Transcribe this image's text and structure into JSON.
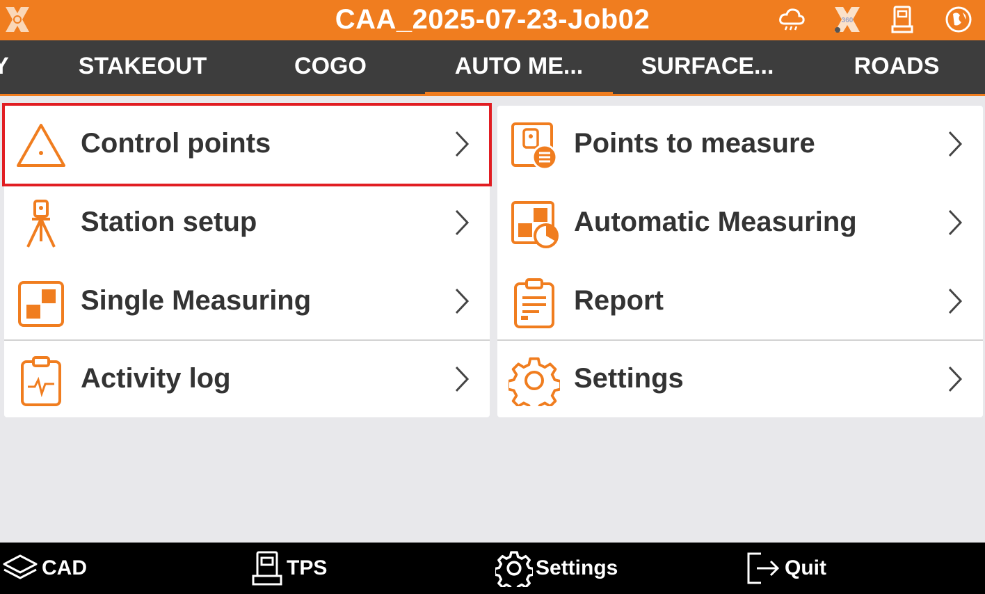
{
  "header": {
    "title": "CAA_2025-07-23-Job02"
  },
  "status_icons": [
    "cloud-weather-icon",
    "satellite-360-icon",
    "total-station-icon",
    "globe-icon"
  ],
  "tabs": [
    {
      "label": "Y",
      "active": false
    },
    {
      "label": "STAKEOUT",
      "active": false
    },
    {
      "label": "COGO",
      "active": false
    },
    {
      "label": "AUTO ME...",
      "active": true
    },
    {
      "label": "SURFACE...",
      "active": false
    },
    {
      "label": "ROADS",
      "active": false
    }
  ],
  "left_menu": [
    {
      "label": "Control points",
      "icon": "triangle-icon",
      "selected": true
    },
    {
      "label": "Station setup",
      "icon": "tripod-icon"
    },
    {
      "label": "Single Measuring",
      "icon": "squares-icon"
    },
    {
      "label": "Activity log",
      "icon": "clipboard-pulse-icon"
    }
  ],
  "right_menu": [
    {
      "label": "Points to measure",
      "icon": "points-list-icon"
    },
    {
      "label": "Automatic Measuring",
      "icon": "auto-measure-icon"
    },
    {
      "label": "Report",
      "icon": "report-icon"
    },
    {
      "label": "Settings",
      "icon": "gear-icon"
    }
  ],
  "bottom_bar": {
    "cad": "CAD",
    "tps": "TPS",
    "settings": "Settings",
    "quit": "Quit"
  },
  "colors": {
    "accent": "#f07d1f",
    "tabbar": "#3d3d3d",
    "highlight": "#e11d22"
  }
}
